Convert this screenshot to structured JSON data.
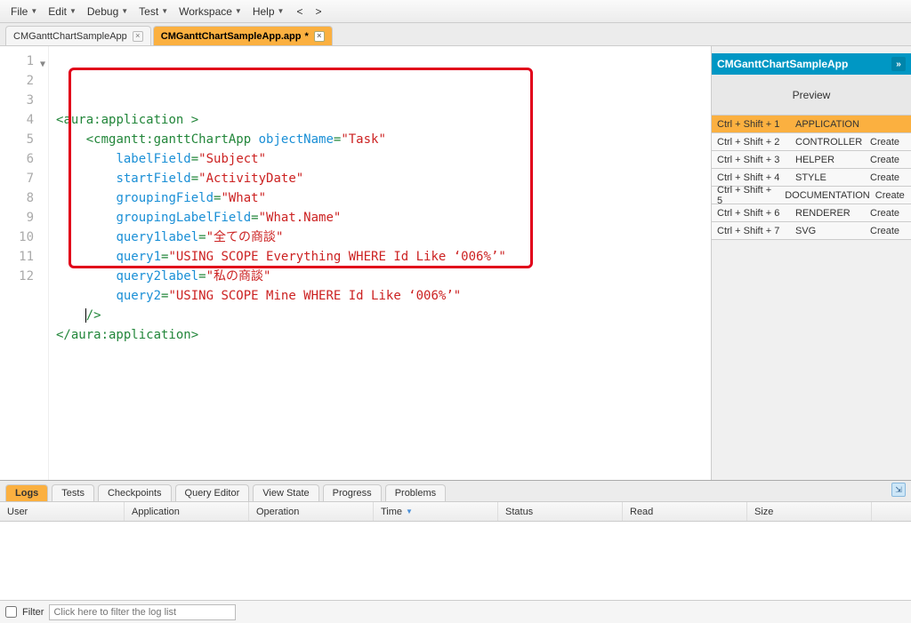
{
  "menu": {
    "items": [
      "File",
      "Edit",
      "Debug",
      "Test",
      "Workspace",
      "Help"
    ]
  },
  "nav": {
    "back": "<",
    "forward": ">"
  },
  "tabs": [
    {
      "label": "CMGanttChartSampleApp",
      "active": false,
      "dirty": false
    },
    {
      "label": "CMGanttChartSampleApp.app",
      "active": true,
      "dirty": true
    }
  ],
  "editor": {
    "line_numbers": [
      "1",
      "2",
      "3",
      "4",
      "5",
      "6",
      "7",
      "8",
      "9",
      "10",
      "11",
      "12"
    ],
    "code_tokens": [
      [
        {
          "t": "punct",
          "v": "<"
        },
        {
          "t": "tag",
          "v": "aura:application "
        },
        {
          "t": "punct",
          "v": ">"
        }
      ],
      [
        {
          "t": "plain",
          "v": "    "
        },
        {
          "t": "punct",
          "v": "<"
        },
        {
          "t": "tag",
          "v": "cmgantt:ganttChartApp "
        },
        {
          "t": "attr",
          "v": "objectName"
        },
        {
          "t": "punct",
          "v": "="
        },
        {
          "t": "str",
          "v": "\"Task\""
        }
      ],
      [
        {
          "t": "plain",
          "v": "        "
        },
        {
          "t": "attr",
          "v": "labelField"
        },
        {
          "t": "punct",
          "v": "="
        },
        {
          "t": "str",
          "v": "\"Subject\""
        }
      ],
      [
        {
          "t": "plain",
          "v": "        "
        },
        {
          "t": "attr",
          "v": "startField"
        },
        {
          "t": "punct",
          "v": "="
        },
        {
          "t": "str",
          "v": "\"ActivityDate\""
        }
      ],
      [
        {
          "t": "plain",
          "v": "        "
        },
        {
          "t": "attr",
          "v": "groupingField"
        },
        {
          "t": "punct",
          "v": "="
        },
        {
          "t": "str",
          "v": "\"What\""
        }
      ],
      [
        {
          "t": "plain",
          "v": "        "
        },
        {
          "t": "attr",
          "v": "groupingLabelField"
        },
        {
          "t": "punct",
          "v": "="
        },
        {
          "t": "str",
          "v": "\"What.Name\""
        }
      ],
      [
        {
          "t": "plain",
          "v": "        "
        },
        {
          "t": "attr",
          "v": "query1label"
        },
        {
          "t": "punct",
          "v": "="
        },
        {
          "t": "str",
          "v": "\"全ての商談\""
        }
      ],
      [
        {
          "t": "plain",
          "v": "        "
        },
        {
          "t": "attr",
          "v": "query1"
        },
        {
          "t": "punct",
          "v": "="
        },
        {
          "t": "str",
          "v": "\"USING SCOPE Everything WHERE Id Like ‘006%’\""
        }
      ],
      [
        {
          "t": "plain",
          "v": "        "
        },
        {
          "t": "attr",
          "v": "query2label"
        },
        {
          "t": "punct",
          "v": "="
        },
        {
          "t": "str",
          "v": "\"私の商談\""
        }
      ],
      [
        {
          "t": "plain",
          "v": "        "
        },
        {
          "t": "attr",
          "v": "query2"
        },
        {
          "t": "punct",
          "v": "="
        },
        {
          "t": "str",
          "v": "\"USING SCOPE Mine WHERE Id Like ‘006%’\""
        }
      ],
      [
        {
          "t": "plain",
          "v": "    "
        },
        {
          "t": "cursor",
          "v": ""
        },
        {
          "t": "punct",
          "v": "/>"
        }
      ],
      [
        {
          "t": "punct",
          "v": "</"
        },
        {
          "t": "tag",
          "v": "aura:application"
        },
        {
          "t": "punct",
          "v": ">"
        }
      ]
    ]
  },
  "side": {
    "title": "CMGanttChartSampleApp",
    "preview": "Preview",
    "rows": [
      {
        "shortcut": "Ctrl + Shift + 1",
        "label": "APPLICATION",
        "action": "",
        "selected": true
      },
      {
        "shortcut": "Ctrl + Shift + 2",
        "label": "CONTROLLER",
        "action": "Create",
        "selected": false
      },
      {
        "shortcut": "Ctrl + Shift + 3",
        "label": "HELPER",
        "action": "Create",
        "selected": false
      },
      {
        "shortcut": "Ctrl + Shift + 4",
        "label": "STYLE",
        "action": "Create",
        "selected": false
      },
      {
        "shortcut": "Ctrl + Shift + 5",
        "label": "DOCUMENTATION",
        "action": "Create",
        "selected": false
      },
      {
        "shortcut": "Ctrl + Shift + 6",
        "label": "RENDERER",
        "action": "Create",
        "selected": false
      },
      {
        "shortcut": "Ctrl + Shift + 7",
        "label": "SVG",
        "action": "Create",
        "selected": false
      }
    ]
  },
  "bottom": {
    "tabs": [
      "Logs",
      "Tests",
      "Checkpoints",
      "Query Editor",
      "View State",
      "Progress",
      "Problems"
    ],
    "active": 0,
    "columns": [
      {
        "label": "User",
        "width": 140
      },
      {
        "label": "Application",
        "width": 140
      },
      {
        "label": "Operation",
        "width": 140
      },
      {
        "label": "Time",
        "width": 140,
        "sorted": true
      },
      {
        "label": "Status",
        "width": 140
      },
      {
        "label": "Read",
        "width": 140
      },
      {
        "label": "Size",
        "width": 140
      }
    ]
  },
  "filter": {
    "label": "Filter",
    "placeholder": "Click here to filter the log list"
  }
}
